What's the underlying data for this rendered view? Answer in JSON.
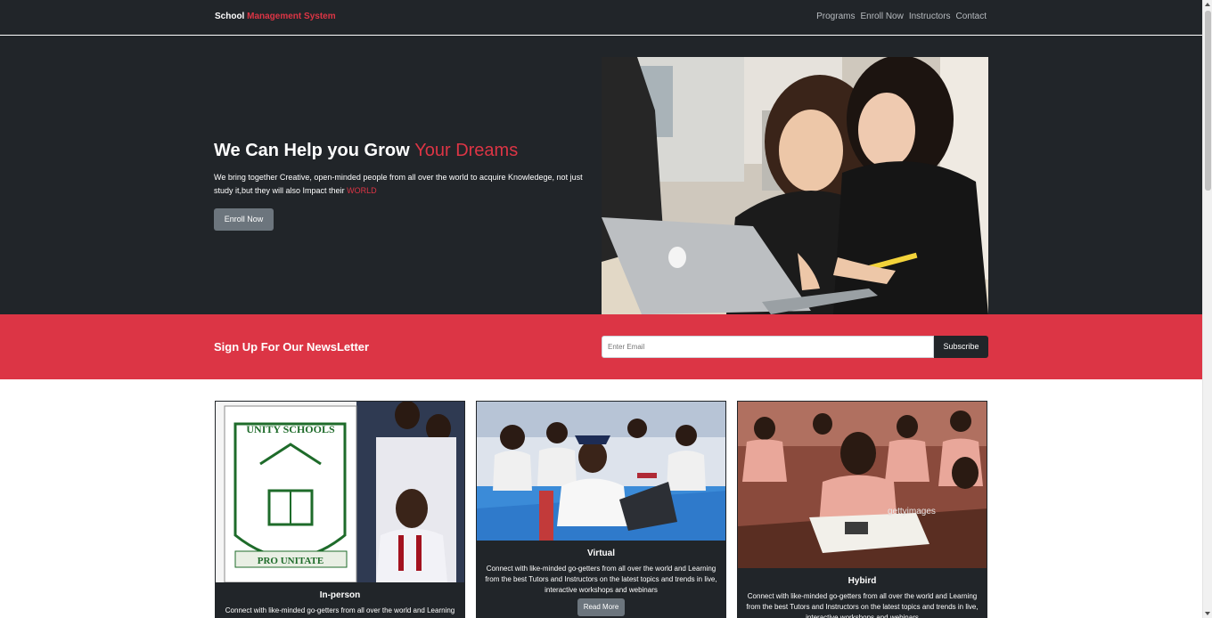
{
  "nav": {
    "brand_part1": "School",
    "brand_part2": "Management System",
    "links": [
      "Programs",
      "Enroll Now",
      "Instructors",
      "Contact"
    ]
  },
  "hero": {
    "title_part1": "We Can Help you Grow",
    "title_part2": "Your Dreams",
    "desc_part1": "We bring together Creative, open-minded people from all over the world to acquire Knowledege, not just study it,but they will also Impact their",
    "desc_part2": "WORLD",
    "button": "Enroll Now"
  },
  "newsletter": {
    "title": "Sign Up For Our NewsLetter",
    "placeholder": "Enter Email",
    "button": "Subscribe"
  },
  "cards": [
    {
      "title": "In-person",
      "text": "Connect with like-minded go-getters from all over the world and Learning from the best Tutors and Instructors on the latest topics and trends in live, interactive workshops and webinars",
      "logo_text_top": "UNITY SCHOOLS",
      "logo_text_bottom": "PRO UNITATE"
    },
    {
      "title": "Virtual",
      "text": "Connect with like-minded go-getters from all over the world and Learning from the best Tutors and Instructors on the latest topics and trends in live, interactive workshops and webinars",
      "button": "Read More"
    },
    {
      "title": "Hybird",
      "text": "Connect with like-minded go-getters from all over the world and Learning from the best Tutors and Instructors on the latest topics and trends in live, interactive workshops and webinars",
      "watermark": "gettyimages"
    }
  ],
  "colors": {
    "dark": "#212529",
    "accent": "#dc3545",
    "secondary": "#6c757d"
  }
}
